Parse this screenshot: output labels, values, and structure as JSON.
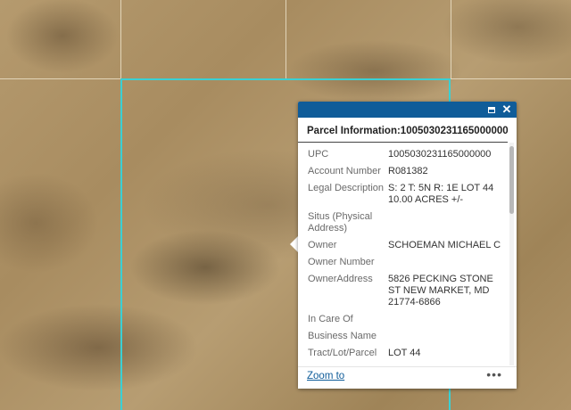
{
  "popup": {
    "title": "Parcel Information:1005030231165000000",
    "zoom_label": "Zoom to",
    "more_label": "•••",
    "fields": [
      {
        "label": "UPC",
        "value": "1005030231165000000"
      },
      {
        "label": "Account Number",
        "value": "R081382"
      },
      {
        "label": "Legal Description",
        "value": "S: 2 T: 5N R: 1E LOT 44 10.00 ACRES +/-"
      },
      {
        "label": "Situs (Physical Address)",
        "value": ""
      },
      {
        "label": "Owner",
        "value": "SCHOEMAN MICHAEL C"
      },
      {
        "label": "Owner Number",
        "value": ""
      },
      {
        "label": "OwnerAddress",
        "value": "5826 PECKING STONE ST NEW MARKET, MD 21774-6866"
      },
      {
        "label": "In Care Of",
        "value": ""
      },
      {
        "label": "Business Name",
        "value": ""
      },
      {
        "label": "Tract/Lot/Parcel",
        "value": "LOT 44"
      }
    ]
  },
  "colors": {
    "header": "#0f5c99",
    "parcel_outline": "#3ad0d4",
    "link": "#0f5c99"
  },
  "icons": {
    "maximize": "maximize-icon",
    "close": "close-icon",
    "more": "more-options-icon"
  }
}
